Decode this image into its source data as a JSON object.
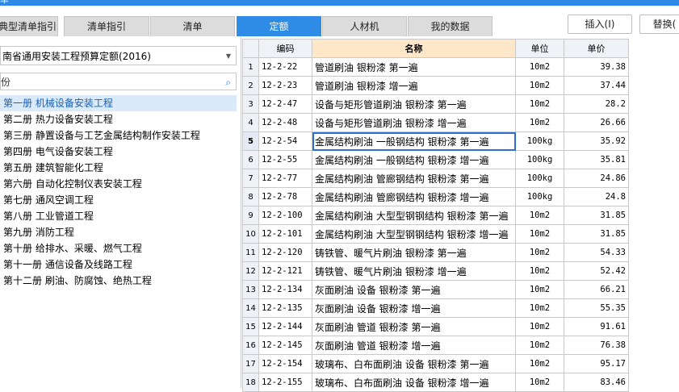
{
  "window": {
    "title_fragment": "单"
  },
  "tabs": [
    {
      "label": "典型清单指引",
      "active": false
    },
    {
      "label": "清单指引",
      "active": false
    },
    {
      "label": "清单",
      "active": false
    },
    {
      "label": "定额",
      "active": true
    },
    {
      "label": "人材机",
      "active": false
    },
    {
      "label": "我的数据",
      "active": false
    }
  ],
  "toolbar": {
    "insert_label": "插入(I)",
    "replace_label": "替换("
  },
  "quota_selector": {
    "value": "南省通用安装工程预算定额(2016)"
  },
  "search": {
    "value": "份"
  },
  "tree": {
    "items": [
      {
        "label": "第一册 机械设备安装工程",
        "selected": true
      },
      {
        "label": "第二册 热力设备安装工程",
        "selected": false
      },
      {
        "label": "第三册 静置设备与工艺金属结构制作安装工程",
        "selected": false
      },
      {
        "label": "第四册 电气设备安装工程",
        "selected": false
      },
      {
        "label": "第五册 建筑智能化工程",
        "selected": false
      },
      {
        "label": "第六册 自动化控制仪表安装工程",
        "selected": false
      },
      {
        "label": "第七册 通风空调工程",
        "selected": false
      },
      {
        "label": "第八册 工业管道工程",
        "selected": false
      },
      {
        "label": "第九册 消防工程",
        "selected": false
      },
      {
        "label": "第十册 给排水、采暖、燃气工程",
        "selected": false
      },
      {
        "label": "第十一册 通信设备及线路工程",
        "selected": false
      },
      {
        "label": "第十二册 刷油、防腐蚀、绝热工程",
        "selected": false
      }
    ]
  },
  "grid": {
    "columns": {
      "code": "编码",
      "name": "名称",
      "unit": "单位",
      "price": "单价"
    },
    "current_row": 5,
    "rows": [
      {
        "no": "1",
        "code": "12-2-22",
        "name": "管道刷油 银粉漆 第一遍",
        "unit": "10m2",
        "price": "39.38"
      },
      {
        "no": "2",
        "code": "12-2-23",
        "name": "管道刷油 银粉漆 增一遍",
        "unit": "10m2",
        "price": "37.44"
      },
      {
        "no": "3",
        "code": "12-2-47",
        "name": "设备与矩形管道刷油 银粉漆 第一遍",
        "unit": "10m2",
        "price": "28.2"
      },
      {
        "no": "4",
        "code": "12-2-48",
        "name": "设备与矩形管道刷油 银粉漆 增一遍",
        "unit": "10m2",
        "price": "26.66"
      },
      {
        "no": "5",
        "code": "12-2-54",
        "name": "金属结构刷油 一般钢结构 银粉漆 第一遍",
        "unit": "100kg",
        "price": "35.92"
      },
      {
        "no": "6",
        "code": "12-2-55",
        "name": "金属结构刷油 一般钢结构 银粉漆 增一遍",
        "unit": "100kg",
        "price": "35.81"
      },
      {
        "no": "7",
        "code": "12-2-77",
        "name": "金属结构刷油 管廊钢结构 银粉漆 第一遍",
        "unit": "100kg",
        "price": "24.86"
      },
      {
        "no": "8",
        "code": "12-2-78",
        "name": "金属结构刷油 管廊钢结构 银粉漆 增一遍",
        "unit": "100kg",
        "price": "24.8"
      },
      {
        "no": "9",
        "code": "12-2-100",
        "name": "金属结构刷油 大型型钢钢结构 银粉漆 第一遍",
        "unit": "10m2",
        "price": "31.85"
      },
      {
        "no": "10",
        "code": "12-2-101",
        "name": "金属结构刷油 大型型钢钢结构 银粉漆 增一遍",
        "unit": "10m2",
        "price": "31.85"
      },
      {
        "no": "11",
        "code": "12-2-120",
        "name": "铸铁管、暖气片刷油 银粉漆 第一遍",
        "unit": "10m2",
        "price": "54.33"
      },
      {
        "no": "12",
        "code": "12-2-121",
        "name": "铸铁管、暖气片刷油 银粉漆 增一遍",
        "unit": "10m2",
        "price": "52.42"
      },
      {
        "no": "13",
        "code": "12-2-134",
        "name": "灰面刷油 设备 银粉漆 第一遍",
        "unit": "10m2",
        "price": "66.21"
      },
      {
        "no": "14",
        "code": "12-2-135",
        "name": "灰面刷油 设备 银粉漆 增一遍",
        "unit": "10m2",
        "price": "55.35"
      },
      {
        "no": "15",
        "code": "12-2-144",
        "name": "灰面刷油 管道 银粉漆 第一遍",
        "unit": "10m2",
        "price": "91.61"
      },
      {
        "no": "16",
        "code": "12-2-145",
        "name": "灰面刷油 管道 银粉漆 增一遍",
        "unit": "10m2",
        "price": "76.38"
      },
      {
        "no": "17",
        "code": "12-2-154",
        "name": "玻璃布、白布面刷油 设备 银粉漆 第一遍",
        "unit": "10m2",
        "price": "95.17"
      },
      {
        "no": "18",
        "code": "12-2-155",
        "name": "玻璃布、白布面刷油 设备 银粉漆 增一遍",
        "unit": "10m2",
        "price": "83.46"
      }
    ]
  },
  "colors": {
    "accent": "#2f8ce6",
    "header_highlight": "#fde7c8",
    "selection": "#dbeaf8"
  }
}
